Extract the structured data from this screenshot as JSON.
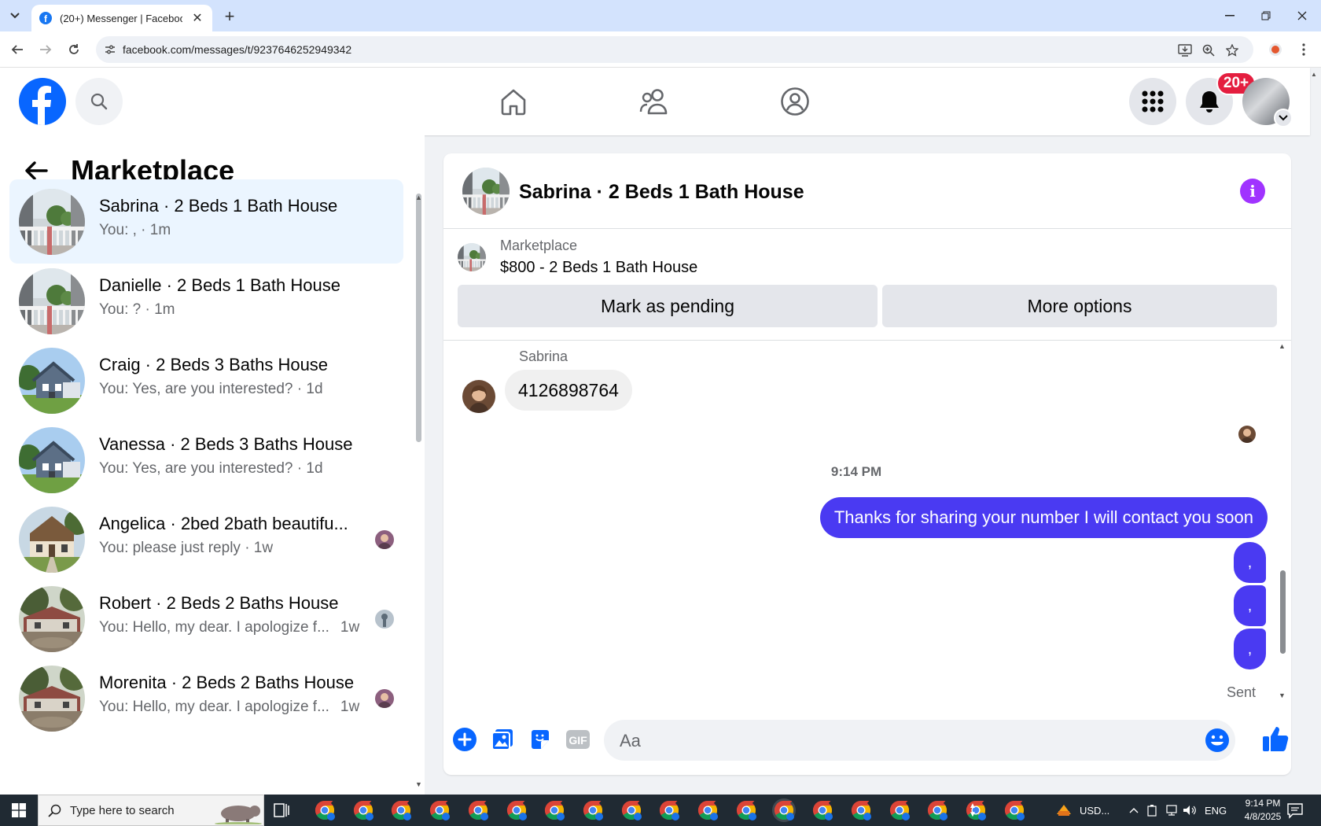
{
  "browser": {
    "tab_title": "(20+) Messenger | Facebook",
    "url": "facebook.com/messages/t/9237646252949342"
  },
  "header": {
    "notification_count": "20+"
  },
  "sidebar": {
    "title": "Marketplace",
    "conversations": [
      {
        "name": "Sabrina · 2 Beds 1 Bath House",
        "preview": "You: , · 1m",
        "time": "",
        "active": true,
        "thumb": "porch"
      },
      {
        "name": "Danielle · 2 Beds 1 Bath House",
        "preview": "You: ? · 1m",
        "time": "",
        "active": false,
        "thumb": "porch"
      },
      {
        "name": "Craig · 2 Beds 3 Baths House",
        "preview": "You: Yes, are you interested? · 1d",
        "time": "",
        "active": false,
        "thumb": "house-blue"
      },
      {
        "name": "Vanessa · 2 Beds 3 Baths House",
        "preview": "You: Yes, are you interested? · 1d",
        "time": "",
        "active": false,
        "thumb": "house-blue"
      },
      {
        "name": "Angelica · 2bed 2bath beautifu...",
        "preview": "You: please just reply · 1w",
        "time": "",
        "active": false,
        "thumb": "house-brown",
        "seen": true
      },
      {
        "name": "Robert · 2 Beds 2 Baths House",
        "preview": "You: Hello, my dear. I apologize f...",
        "time": "1w",
        "active": false,
        "thumb": "house-red",
        "seen": true
      },
      {
        "name": "Morenita · 2 Beds 2 Baths House",
        "preview": "You: Hello, my dear. I apologize f...",
        "time": "1w",
        "active": false,
        "thumb": "house-red",
        "seen": true
      }
    ]
  },
  "chat": {
    "title": "Sabrina · 2 Beds 1 Bath House",
    "marketplace_label": "Marketplace",
    "listing": "$800 - 2 Beds 1 Bath House",
    "mark_pending": "Mark as pending",
    "more_options": "More options",
    "sender": "Sabrina",
    "incoming_message": "4126898764",
    "timestamp": "9:14 PM",
    "outgoing_message": "Thanks for sharing your number I will contact you soon",
    "small_messages": [
      ",",
      ",",
      ","
    ],
    "status": "Sent",
    "composer_placeholder": "Aa"
  },
  "taskbar": {
    "search_placeholder": "Type here to search",
    "tray_app": "USD...",
    "language": "ENG",
    "time": "9:14 PM",
    "date": "4/8/2025"
  },
  "colors": {
    "fb_blue": "#0866ff",
    "messenger_bubble": "#4a3af2",
    "badge_red": "#e41e3f",
    "info_purple": "#a033ff"
  }
}
